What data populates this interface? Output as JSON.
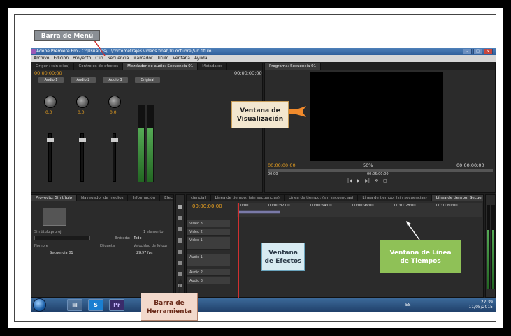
{
  "window": {
    "title": "Adobe Premiere Pro - C:\\Usuarios\\...\\cortometrajes videos final\\10 octubre\\Sin título"
  },
  "menu": [
    "Archivo",
    "Edición",
    "Proyecto",
    "Clip",
    "Secuencia",
    "Marcador",
    "Título",
    "Ventana",
    "Ayuda"
  ],
  "source_panel": {
    "tabs": [
      "Origen: (sin clips)",
      "Controles de efectos",
      "Mezclador de audio: Secuencia 01",
      "Metadatos"
    ],
    "timecode_left": "00:00:00:00",
    "timecode_right": "00:00:00:00",
    "channels": [
      "Audio 1",
      "Audio 2",
      "Audio 3",
      "Original"
    ],
    "knob_value": "0,0"
  },
  "program_panel": {
    "tab": "Programa: Secuencia 01",
    "timecode_left": "00:00:00:00",
    "zoom": "50%",
    "timecode_right": "00:00:00:00",
    "ruler_left": "00:00",
    "ruler_mid": "00:05:00:00"
  },
  "project_panel": {
    "tabs": [
      "Proyecto: Sin título",
      "Navegador de medios",
      "Información",
      "Efectos"
    ],
    "project_name": "Sin título.prproj",
    "item_count": "1 elemento",
    "entry_label": "Entrada:",
    "entry_value": "Todo",
    "columns": [
      "Nombre",
      "Etiqueta",
      "Velocidad de fotogr"
    ],
    "row": {
      "name": "Secuencia 01",
      "fps": "29,97 fps"
    }
  },
  "timeline_panel": {
    "tabs": [
      "ciencia)",
      "Línea de tiempo: (sin secuencias)",
      "Línea de tiempo: (sin secuencias)",
      "Línea de tiempo: (sin secuencias)",
      "Línea de tiempo: Secuencia 01"
    ],
    "timecode": "00:00:00:00",
    "ruler": [
      "00:00",
      "00:00:32:00",
      "00:00:64:00",
      "00:00:96:00",
      "00:01:28:00",
      "00:01:60:00"
    ],
    "tracks": [
      "Video 3",
      "Video 2",
      "Video 1",
      "Audio 1",
      "Audio 2",
      "Audio 3"
    ]
  },
  "taskbar": {
    "lang": "ES",
    "time": "22:39",
    "date": "11/05/2015"
  },
  "annotations": {
    "menu_bar": "Barra de Menú",
    "vis_l1": "Ventana de",
    "vis_l2": "Visualización",
    "ef_l1": "Ventana",
    "ef_l2": "de Efectos",
    "lt_l1": "Ventana de Línea",
    "lt_l2": "de Tiempos",
    "ht_l1": "Barra de",
    "ht_l2": "Herramienta"
  },
  "colors": {
    "accent_timecode": "#e8a020",
    "arrow_orange": "#f08a2c",
    "arrow_red": "#d03030"
  }
}
